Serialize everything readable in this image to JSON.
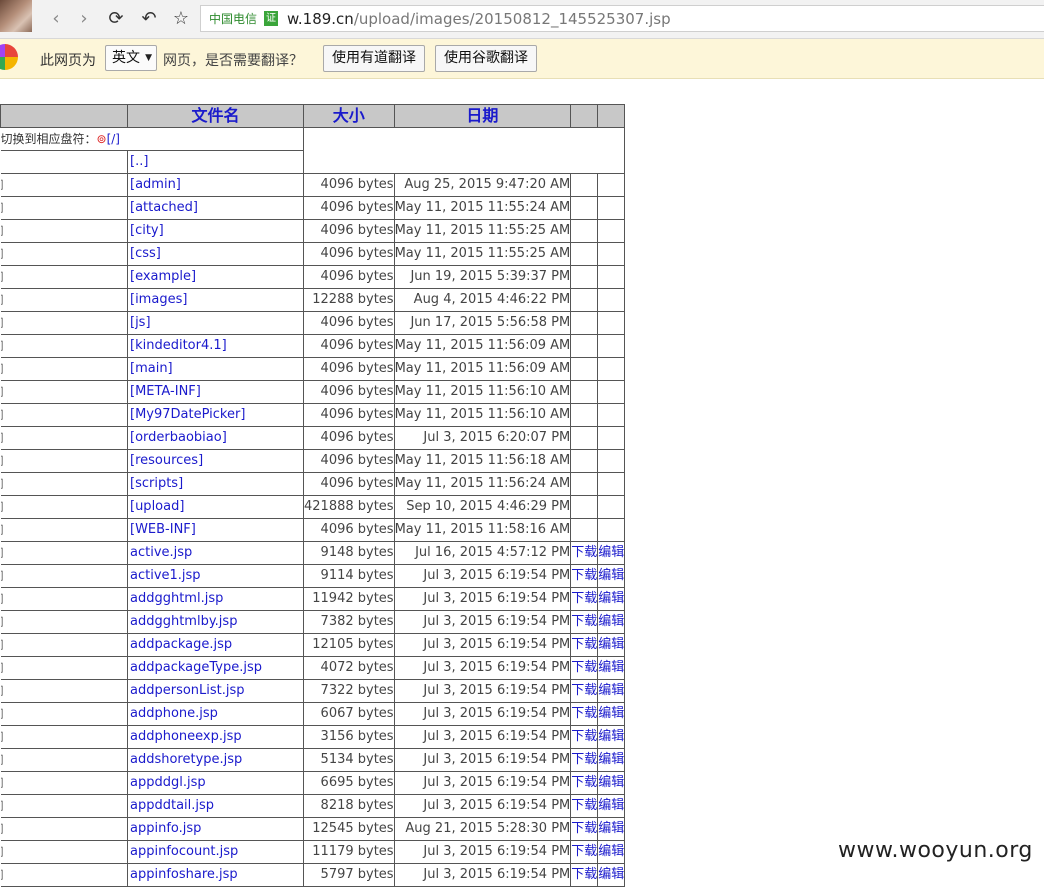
{
  "browser": {
    "nav": {
      "back_icon": "‹",
      "forward_icon": "›",
      "reload_icon": "⟳",
      "undo_icon": "↶",
      "star_icon": "☆"
    },
    "address": {
      "carrier": "中国电信",
      "cert_badge": "证",
      "url_host": "w.189.cn",
      "url_path": "/upload/images/20150812_145525307.jsp"
    }
  },
  "translate_bar": {
    "msg_prefix": "此网页为",
    "language": "英文",
    "msg_suffix": "网页，是否需要翻译？",
    "youdao_button": "使用有道翻译",
    "google_button": "使用谷歌翻译"
  },
  "listing": {
    "headers": {
      "name": "文件名",
      "size": "大小",
      "date": "日期"
    },
    "drive_label": "切换到相应盘符：",
    "drive_icon": "⊚",
    "drive_link": "[/]",
    "parent_link": "[..]",
    "download_label": "下载",
    "edit_label": "编辑",
    "rows": [
      {
        "name": "[admin]",
        "size": "4096 bytes",
        "date": "Aug 25, 2015 9:47:20 AM",
        "file": false
      },
      {
        "name": "[attached]",
        "size": "4096 bytes",
        "date": "May 11, 2015 11:55:24 AM",
        "file": false
      },
      {
        "name": "[city]",
        "size": "4096 bytes",
        "date": "May 11, 2015 11:55:25 AM",
        "file": false
      },
      {
        "name": "[css]",
        "size": "4096 bytes",
        "date": "May 11, 2015 11:55:25 AM",
        "file": false
      },
      {
        "name": "[example]",
        "size": "4096 bytes",
        "date": "Jun 19, 2015 5:39:37 PM",
        "file": false
      },
      {
        "name": "[images]",
        "size": "12288 bytes",
        "date": "Aug 4, 2015 4:46:22 PM",
        "file": false
      },
      {
        "name": "[js]",
        "size": "4096 bytes",
        "date": "Jun 17, 2015 5:56:58 PM",
        "file": false
      },
      {
        "name": "[kindeditor4.1]",
        "size": "4096 bytes",
        "date": "May 11, 2015 11:56:09 AM",
        "file": false
      },
      {
        "name": "[main]",
        "size": "4096 bytes",
        "date": "May 11, 2015 11:56:09 AM",
        "file": false
      },
      {
        "name": "[META-INF]",
        "size": "4096 bytes",
        "date": "May 11, 2015 11:56:10 AM",
        "file": false
      },
      {
        "name": "[My97DatePicker]",
        "size": "4096 bytes",
        "date": "May 11, 2015 11:56:10 AM",
        "file": false
      },
      {
        "name": "[orderbaobiao]",
        "size": "4096 bytes",
        "date": "Jul 3, 2015 6:20:07 PM",
        "file": false
      },
      {
        "name": "[resources]",
        "size": "4096 bytes",
        "date": "May 11, 2015 11:56:18 AM",
        "file": false
      },
      {
        "name": "[scripts]",
        "size": "4096 bytes",
        "date": "May 11, 2015 11:56:24 AM",
        "file": false
      },
      {
        "name": "[upload]",
        "size": "421888 bytes",
        "date": "Sep 10, 2015 4:46:29 PM",
        "file": false
      },
      {
        "name": "[WEB-INF]",
        "size": "4096 bytes",
        "date": "May 11, 2015 11:58:16 AM",
        "file": false
      },
      {
        "name": "active.jsp",
        "size": "9148 bytes",
        "date": "Jul 16, 2015 4:57:12 PM",
        "file": true
      },
      {
        "name": "active1.jsp",
        "size": "9114 bytes",
        "date": "Jul 3, 2015 6:19:54 PM",
        "file": true
      },
      {
        "name": "addgghtml.jsp",
        "size": "11942 bytes",
        "date": "Jul 3, 2015 6:19:54 PM",
        "file": true
      },
      {
        "name": "addgghtmlby.jsp",
        "size": "7382 bytes",
        "date": "Jul 3, 2015 6:19:54 PM",
        "file": true
      },
      {
        "name": "addpackage.jsp",
        "size": "12105 bytes",
        "date": "Jul 3, 2015 6:19:54 PM",
        "file": true
      },
      {
        "name": "addpackageType.jsp",
        "size": "4072 bytes",
        "date": "Jul 3, 2015 6:19:54 PM",
        "file": true
      },
      {
        "name": "addpersonList.jsp",
        "size": "7322 bytes",
        "date": "Jul 3, 2015 6:19:54 PM",
        "file": true
      },
      {
        "name": "addphone.jsp",
        "size": "6067 bytes",
        "date": "Jul 3, 2015 6:19:54 PM",
        "file": true
      },
      {
        "name": "addphoneexp.jsp",
        "size": "3156 bytes",
        "date": "Jul 3, 2015 6:19:54 PM",
        "file": true
      },
      {
        "name": "addshoretype.jsp",
        "size": "5134 bytes",
        "date": "Jul 3, 2015 6:19:54 PM",
        "file": true
      },
      {
        "name": "appddgl.jsp",
        "size": "6695 bytes",
        "date": "Jul 3, 2015 6:19:54 PM",
        "file": true
      },
      {
        "name": "appddtail.jsp",
        "size": "8218 bytes",
        "date": "Jul 3, 2015 6:19:54 PM",
        "file": true
      },
      {
        "name": "appinfo.jsp",
        "size": "12545 bytes",
        "date": "Aug 21, 2015 5:28:30 PM",
        "file": true
      },
      {
        "name": "appinfocount.jsp",
        "size": "11179 bytes",
        "date": "Jul 3, 2015 6:19:54 PM",
        "file": true
      },
      {
        "name": "appinfoshare.jsp",
        "size": "5797 bytes",
        "date": "Jul 3, 2015 6:19:54 PM",
        "file": true
      }
    ]
  },
  "watermark": "www.wooyun.org"
}
